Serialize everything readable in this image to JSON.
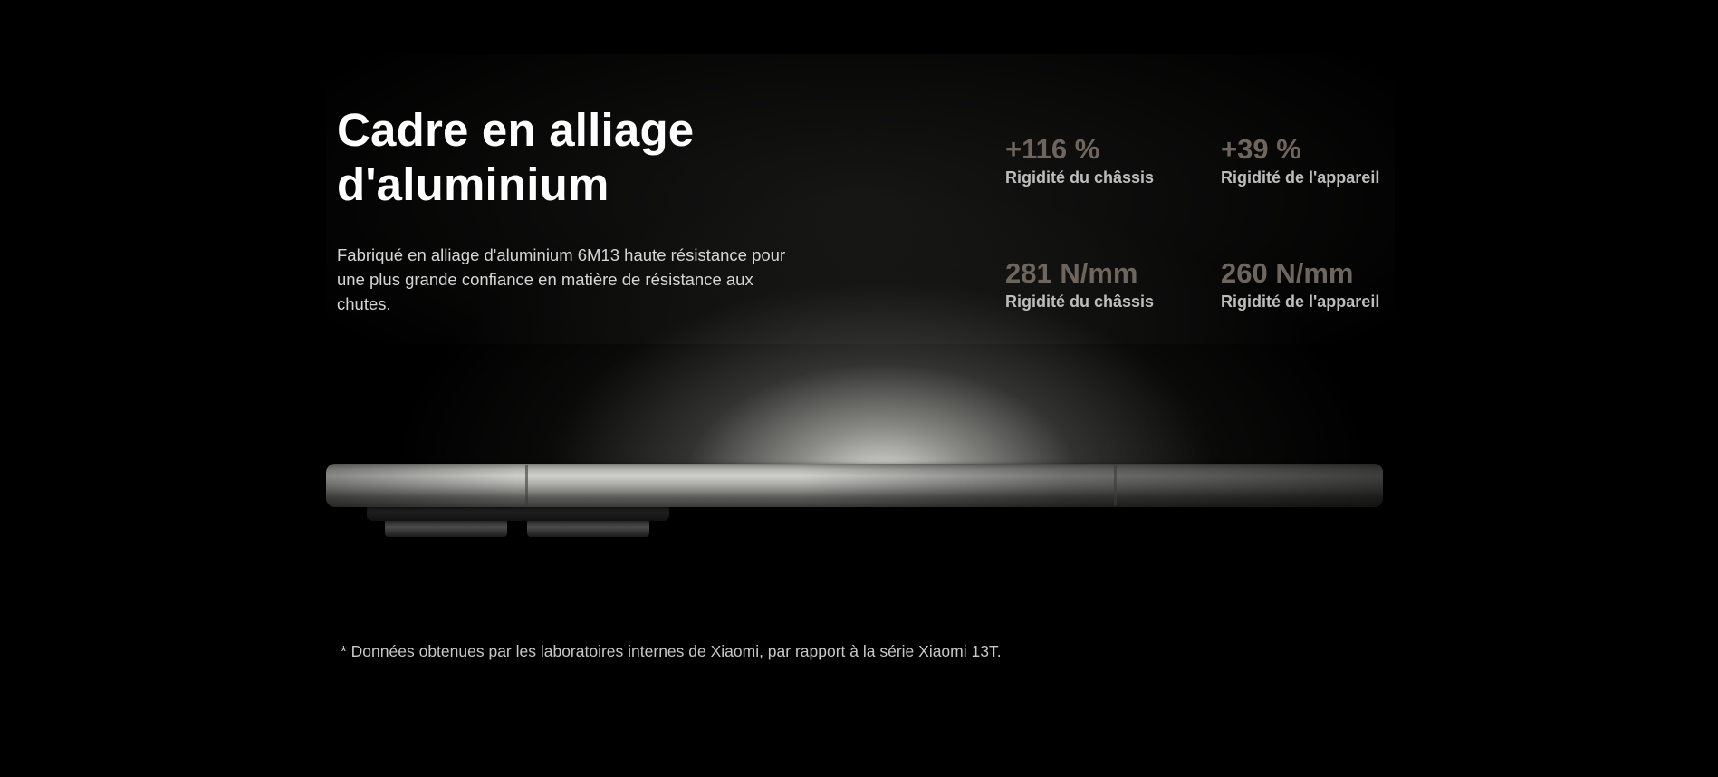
{
  "section": {
    "title_line1": "Cadre en alliage",
    "title_line2": "d'aluminium",
    "description": "Fabriqué en alliage d'aluminium 6M13 haute résistance pour une plus grande confiance en matière de résistance aux chutes."
  },
  "stats": [
    {
      "value": "+116 %",
      "label": "Rigidité du châssis"
    },
    {
      "value": "+39 %",
      "label": "Rigidité de l'appareil"
    },
    {
      "value": "281 N/mm",
      "label": "Rigidité du châssis"
    },
    {
      "value": "260 N/mm",
      "label": "Rigidité de l'appareil"
    }
  ],
  "footnote": "* Données obtenues par les laboratoires internes de Xiaomi, par rapport à la série Xiaomi 13T.",
  "colors": {
    "background": "#000000",
    "stat_value": "#6e655d",
    "stat_label": "#bdbdbd",
    "headline": "#ffffff"
  }
}
